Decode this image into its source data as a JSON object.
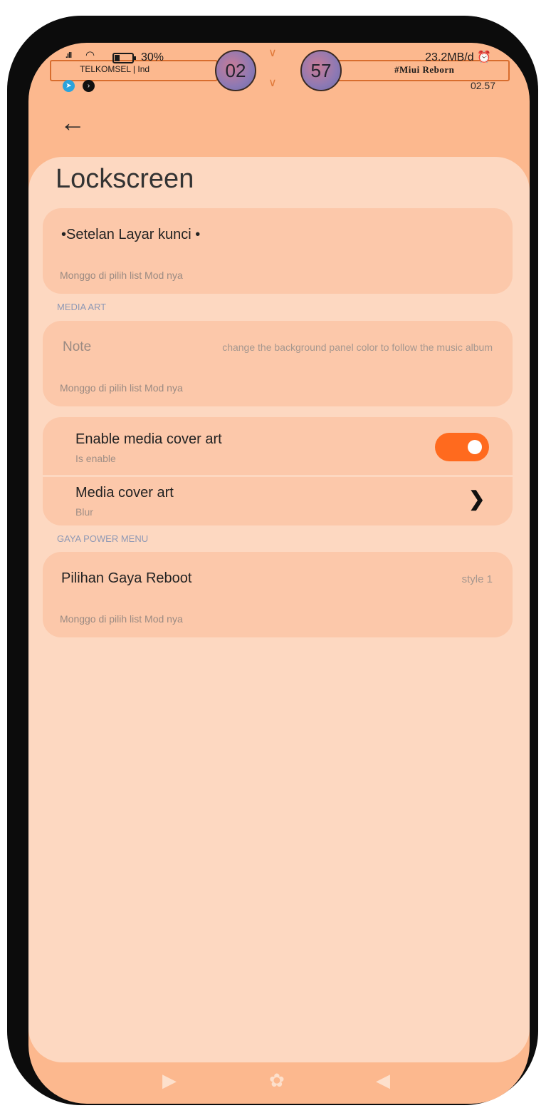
{
  "status_bar": {
    "signal_icon": "signal-bars-icon",
    "wifi_icon": "wifi-icon",
    "battery_icon": "battery-icon",
    "battery_percent": "30%",
    "carrier": "TELKOMSEL | Ind",
    "clock_hour": "02",
    "clock_minute": "57",
    "network_speed": "23.2MB/d",
    "alarm_icon": "alarm-off-icon",
    "brand": "#Miui Reborn",
    "time_small": "02.57",
    "notification_icons": [
      "telegram-icon",
      "terminal-icon"
    ]
  },
  "header": {
    "back_icon": "back-arrow-icon",
    "title": "Lockscreen"
  },
  "cards": {
    "lock_settings": {
      "title": "•Setelan Layar kunci •",
      "subtitle": "Monggo di pilih list Mod nya"
    },
    "note": {
      "label": "Note",
      "value": "change the background panel color to follow the music album",
      "subtitle": "Monggo di pilih list Mod nya"
    },
    "reboot_style": {
      "title": "Pilihan Gaya Reboot",
      "value": "style 1",
      "subtitle": "Monggo di pilih list Mod nya"
    }
  },
  "sections": {
    "media_art": "MEDIA ART",
    "power_menu": "GAYA POWER MENU"
  },
  "media_group": {
    "enable_title": "Enable media cover art",
    "enable_sub": "Is enable",
    "toggle_on": true,
    "cover_title": "Media cover art",
    "cover_sub": "Blur"
  },
  "colors": {
    "accent": "#ff6a1e",
    "background": "#fcb88e",
    "sheet": "#fdd8c1",
    "card": "#fcc8aa"
  }
}
